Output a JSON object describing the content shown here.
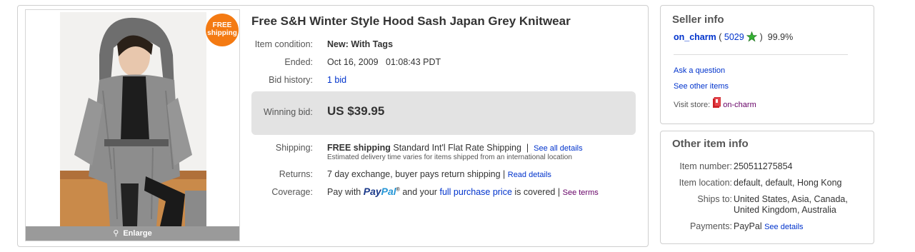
{
  "item": {
    "title": "Free S&H Winter Style Hood Sash Japan Grey Knitwear",
    "badge_line1": "FREE",
    "badge_line2": "shipping",
    "enlarge": "Enlarge",
    "condition_label": "Item condition:",
    "condition_value": "New: With Tags",
    "ended_label": "Ended:",
    "ended_value": "Oct 16, 2009   01:08:43 PDT",
    "bid_history_label": "Bid history:",
    "bid_history_value": "1 bid",
    "winning_bid_label": "Winning bid:",
    "winning_bid_value": "US $39.95",
    "shipping_label": "Shipping:",
    "shipping_free": "FREE shipping",
    "shipping_method": "Standard Int'l Flat Rate Shipping",
    "separator": "|",
    "shipping_details_link": "See all details",
    "shipping_note": "Estimated delivery time varies for items shipped from an international location",
    "returns_label": "Returns:",
    "returns_value": "7 day exchange, buyer pays return shipping",
    "returns_link": "Read details",
    "coverage_label": "Coverage:",
    "coverage_prefix": "Pay with",
    "paypal_pay": "Pay",
    "paypal_pal": "Pal",
    "paypal_tm": "®",
    "coverage_middle": "and your",
    "coverage_link": "full purchase price",
    "coverage_suffix": "is covered",
    "coverage_terms_link": "See terms"
  },
  "seller": {
    "header": "Seller info",
    "username": "on_charm",
    "paren_open": "(",
    "feedback_score": "5029",
    "paren_close": ")",
    "positive_pct": "99.9%",
    "ask_question": "Ask a question",
    "see_other_items": "See other items",
    "visit_store_label": "Visit store:",
    "store_name": "on-charm"
  },
  "other_info": {
    "header": "Other item info",
    "item_number_label": "Item number:",
    "item_number_value": "250511275854",
    "item_location_label": "Item location:",
    "item_location_value": "default, default, Hong Kong",
    "ships_to_label": "Ships to:",
    "ships_to_value": "United States, Asia, Canada, United Kingdom, Australia",
    "payments_label": "Payments:",
    "payments_value": "PayPal",
    "payments_link": "See details"
  },
  "colors": {
    "link": "#0033cc",
    "visited_link": "#660066",
    "badge": "#f47a12",
    "winning_bg": "#e3e3e3",
    "star": "#34b233"
  },
  "icons": {
    "feedback_star": "green-star-icon",
    "store": "store-door-icon",
    "enlarge": "magnifier-icon"
  }
}
